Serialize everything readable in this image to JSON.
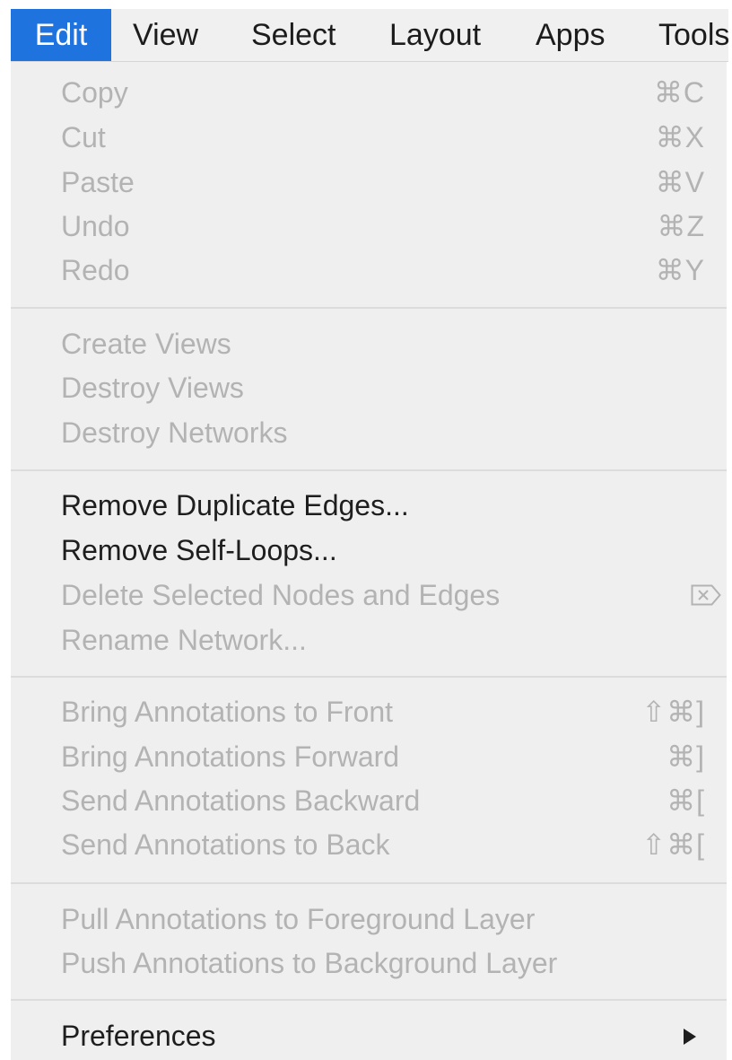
{
  "menubar": {
    "items": [
      "Edit",
      "View",
      "Select",
      "Layout",
      "Apps",
      "Tools"
    ],
    "active": "Edit"
  },
  "edit_menu": {
    "clipboard": [
      {
        "label": "Copy",
        "shortcut": "⌘C",
        "enabled": false
      },
      {
        "label": "Cut",
        "shortcut": "⌘X",
        "enabled": false
      },
      {
        "label": "Paste",
        "shortcut": "⌘V",
        "enabled": false
      },
      {
        "label": "Undo",
        "shortcut": "⌘Z",
        "enabled": false
      },
      {
        "label": "Redo",
        "shortcut": "⌘Y",
        "enabled": false
      }
    ],
    "views": [
      {
        "label": "Create Views",
        "enabled": false
      },
      {
        "label": "Destroy Views",
        "enabled": false
      },
      {
        "label": "Destroy Networks",
        "enabled": false
      }
    ],
    "network": [
      {
        "label": "Remove Duplicate Edges...",
        "enabled": true
      },
      {
        "label": "Remove Self-Loops...",
        "enabled": true
      },
      {
        "label": "Delete Selected Nodes and Edges",
        "shortcut_icon": "delete-key-icon",
        "enabled": false
      },
      {
        "label": "Rename Network...",
        "enabled": false
      }
    ],
    "annotations_order": [
      {
        "label": "Bring Annotations to Front",
        "shortcut": "⇧⌘]",
        "enabled": false
      },
      {
        "label": "Bring Annotations Forward",
        "shortcut": "⌘]",
        "enabled": false
      },
      {
        "label": "Send Annotations Backward",
        "shortcut": "⌘[",
        "enabled": false
      },
      {
        "label": "Send Annotations to Back",
        "shortcut": "⇧⌘[",
        "enabled": false
      }
    ],
    "annotations_layer": [
      {
        "label": "Pull Annotations to Foreground Layer",
        "enabled": false
      },
      {
        "label": "Push Annotations to Background Layer",
        "enabled": false
      }
    ],
    "preferences": {
      "label": "Preferences",
      "submenu_icon": "submenu-arrow-icon",
      "enabled": true
    }
  },
  "colors": {
    "highlight": "#1f73de",
    "menu_background": "#efefef",
    "enabled_text": "#1e1e1e",
    "disabled_text": "#b3b3b3",
    "separator": "#dcdcdc"
  }
}
